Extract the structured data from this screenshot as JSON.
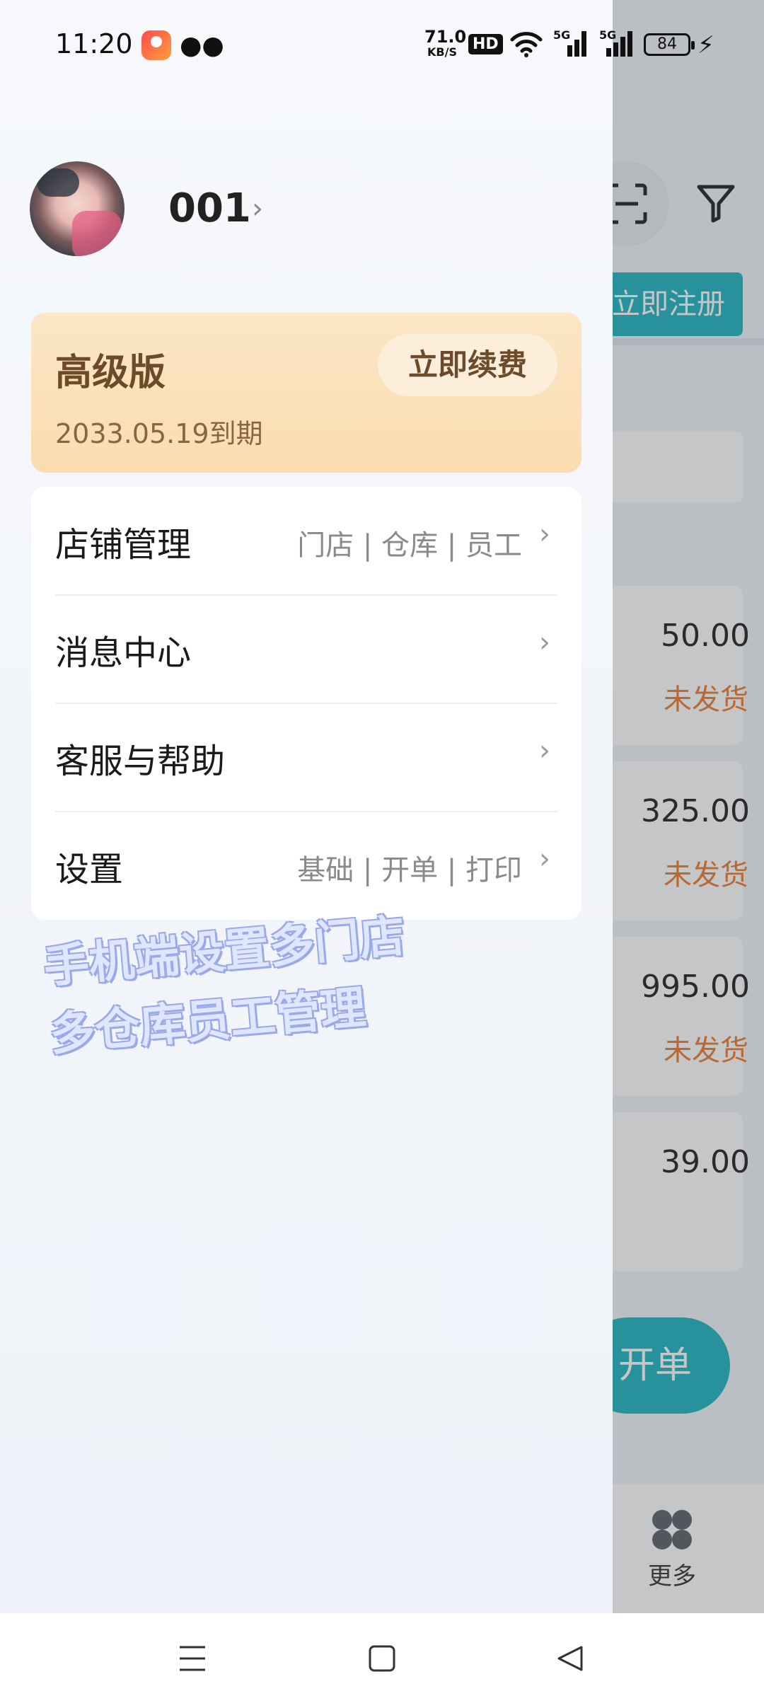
{
  "status_bar": {
    "time": "11:20",
    "net_speed_value": "71.0",
    "net_speed_unit": "KB/S",
    "hd_label": "HD",
    "signal1_tag": "5G",
    "signal2_tag": "5G",
    "battery": "84"
  },
  "drawer": {
    "username": "001",
    "premium": {
      "title": "高级版",
      "expiry": "2033.05.19到期",
      "renew_label": "立即续费"
    },
    "menu": [
      {
        "label": "店铺管理",
        "sub": "门店 | 仓库 | 员工"
      },
      {
        "label": "消息中心",
        "sub": ""
      },
      {
        "label": "客服与帮助",
        "sub": ""
      },
      {
        "label": "设置",
        "sub": "基础 | 开单 | 打印"
      }
    ],
    "promo_overlay": [
      "手机端设置多门店",
      "多仓库员工管理"
    ]
  },
  "background_app": {
    "register_label": "立即注册",
    "orders": [
      {
        "amount": "50.00",
        "status": "未发货"
      },
      {
        "amount": "325.00",
        "status": "未发货"
      },
      {
        "amount": "995.00",
        "status": "未发货"
      },
      {
        "amount": "39.00",
        "status": ""
      }
    ],
    "fab_label": "开单",
    "tab_more_label": "更多"
  },
  "colors": {
    "accent": "#1fb5bf",
    "premium_bg": "#fbe2bc",
    "pending_status": "#f07a2a"
  },
  "icons": [
    "scan-icon",
    "filter-icon",
    "chevron-right-icon",
    "more-icon",
    "nav-menu-icon",
    "nav-home-icon",
    "nav-back-icon"
  ]
}
